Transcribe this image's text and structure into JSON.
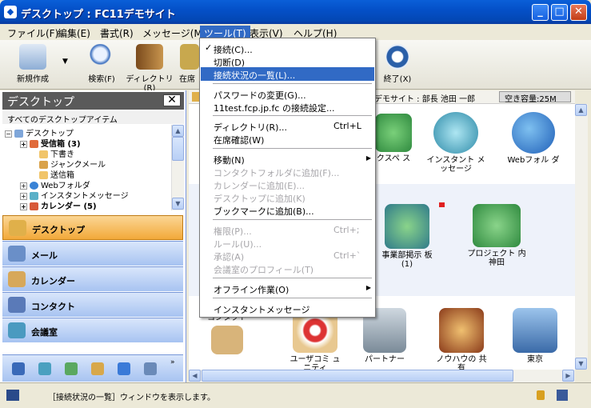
{
  "window": {
    "title": "デスクトップ : FC11デモサイト"
  },
  "menubar": [
    "ファイル(F)",
    "編集(E)",
    "書式(R)",
    "メッセージ(M)",
    "ツール(T)",
    "表示(V)",
    "ヘルプ(H)"
  ],
  "toolbar": {
    "new": "新規作成",
    "search": "検索(F)",
    "directory": "ディレクトリ(R)",
    "presence": "在席",
    "exit": "終了(X)"
  },
  "left": {
    "header": "デスクトップ",
    "close": "✕",
    "subheader": "すべてのデスクトップアイテム",
    "tree": [
      "デスクトップ",
      "受信箱 (3)",
      "下書き",
      "ジャンクメール",
      "送信箱",
      "Webフォルダ",
      "インスタントメッセージ",
      "カレンダー (5)"
    ],
    "nav": [
      "デスクトップ",
      "メール",
      "カレンダー",
      "コンタクト",
      "会議室"
    ]
  },
  "location": {
    "text": "デモサイト : 部長 池田 一郎",
    "capacity": "空き容量:25M"
  },
  "desktop_icons": [
    "クスペ ス",
    "インスタント メッセージ",
    "Webフォル ダ",
    "事業部掲示 板 (1)",
    "プロジェクト 内神田",
    "コンタクト",
    "ユーザコミ ュニティ",
    "パートナー",
    "ノウハウの 共有",
    "東京"
  ],
  "status": "［接続状況の一覧］ウィンドウを表示します。",
  "menu": {
    "items": [
      {
        "label": "接続(C)...",
        "check": "✓"
      },
      {
        "label": "切断(D)"
      },
      {
        "label": "接続状況の一覧(L)..."
      },
      {
        "label": "パスワードの変更(G)..."
      },
      {
        "label": "11test.fcp.jp.fc の接続設定..."
      },
      {
        "label": "ディレクトリ(R)...",
        "shortcut": "Ctrl+L"
      },
      {
        "label": "在席確認(W)"
      },
      {
        "label": "移動(N)",
        "arrow": "▶"
      },
      {
        "label": "コンタクトフォルダに追加(F)..."
      },
      {
        "label": "カレンダーに追加(E)..."
      },
      {
        "label": "デスクトップに追加(K)"
      },
      {
        "label": "ブックマークに追加(B)..."
      },
      {
        "label": "権限(P)...",
        "shortcut": "Ctrl+;"
      },
      {
        "label": "ルール(U)..."
      },
      {
        "label": "承認(A)",
        "shortcut": "Ctrl+`"
      },
      {
        "label": "会議室のプロフィール(T)"
      },
      {
        "label": "オフライン作業(O)",
        "arrow": "▶"
      },
      {
        "label": "インスタントメッセージ"
      }
    ]
  }
}
